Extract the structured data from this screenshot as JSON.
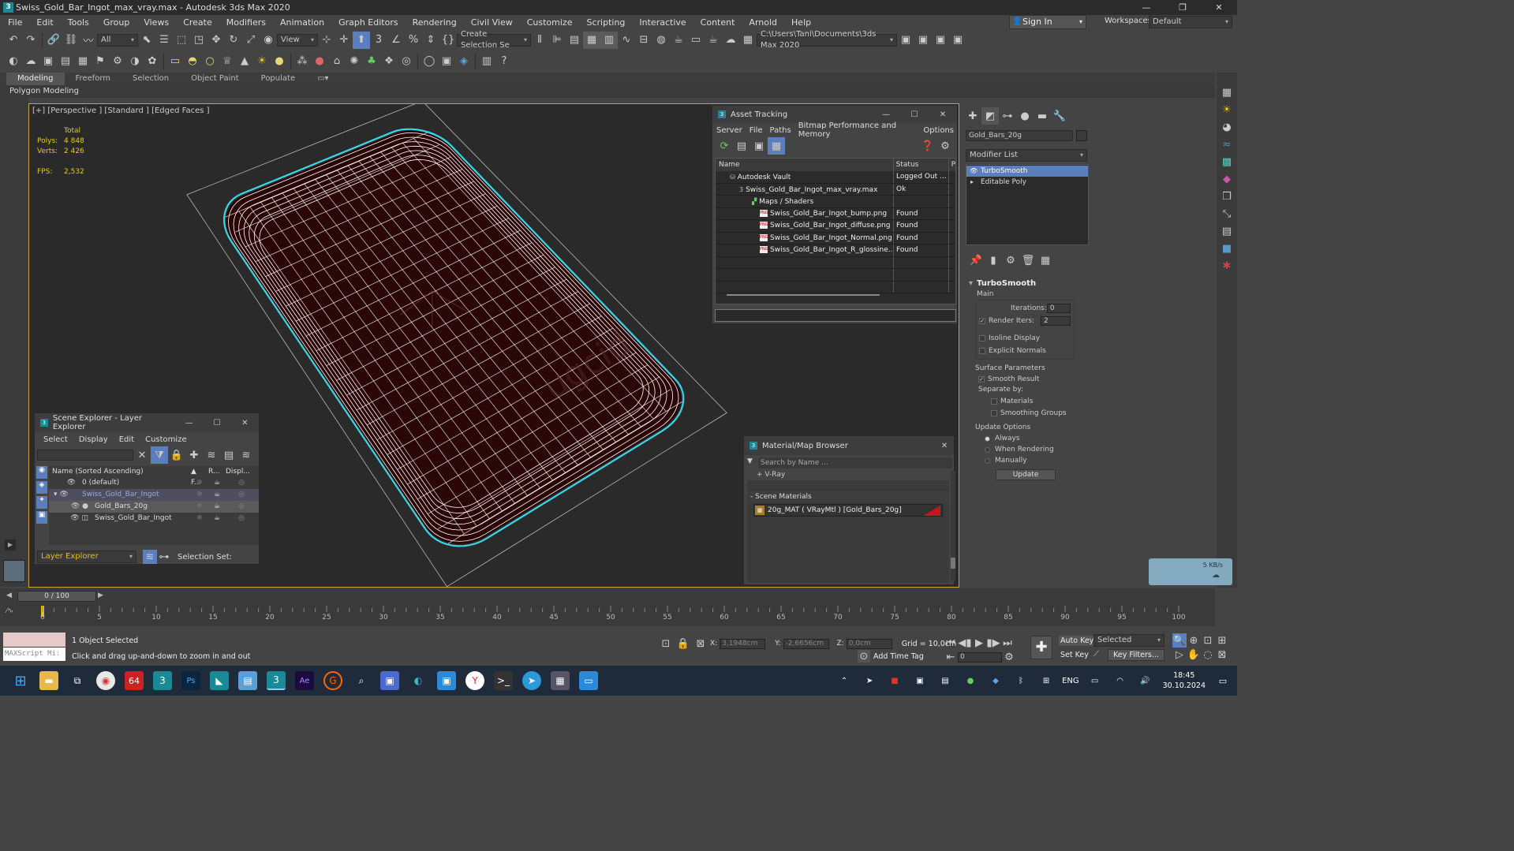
{
  "window": {
    "title": "Swiss_Gold_Bar_Ingot_max_vray.max - Autodesk 3ds Max 2020",
    "app_icon": "3",
    "minimize": "—",
    "maximize": "❐",
    "close": "✕"
  },
  "menu": [
    "File",
    "Edit",
    "Tools",
    "Group",
    "Views",
    "Create",
    "Modifiers",
    "Animation",
    "Graph Editors",
    "Rendering",
    "Civil View",
    "Customize",
    "Scripting",
    "Interactive",
    "Content",
    "Arnold",
    "Help"
  ],
  "account": {
    "signin": "Sign In",
    "workspaces_label": "Workspaces:",
    "workspace_value": "Default"
  },
  "toolbar": {
    "filter_value": "All",
    "refcoord_value": "View",
    "selection_set_value": "Create Selection Se",
    "project_path": "C:\\Users\\Tani\\Documents\\3ds Max 2020"
  },
  "ribbon": {
    "tabs": [
      "Modeling",
      "Freeform",
      "Selection",
      "Object Paint",
      "Populate"
    ],
    "active_tab": "Modeling",
    "sub_label": "Polygon Modeling"
  },
  "viewport": {
    "label": "[+] [Perspective ] [Standard ] [Edged Faces ]",
    "stats": {
      "total_label": "Total",
      "polys_label": "Polys:",
      "polys_value": "4 848",
      "verts_label": "Verts:",
      "verts_value": "2 426",
      "fps_label": "FPS:",
      "fps_value": "2,532"
    },
    "watermark": "ugcid"
  },
  "asset_tracking": {
    "title": "Asset Tracking",
    "menu": [
      "Server",
      "File",
      "Paths",
      "Bitmap Performance and Memory",
      "Options"
    ],
    "columns": [
      "Name",
      "Status",
      "P"
    ],
    "rows": [
      {
        "name": "Autodesk Vault",
        "status": "Logged Out ...",
        "indent": 18,
        "icon": "vault"
      },
      {
        "name": "Swiss_Gold_Bar_Ingot_max_vray.max",
        "status": "Ok",
        "indent": 30,
        "icon": "max"
      },
      {
        "name": "Maps / Shaders",
        "status": "",
        "indent": 46,
        "icon": "maps"
      },
      {
        "name": "Swiss_Gold_Bar_Ingot_bump.png",
        "status": "Found",
        "indent": 56,
        "icon": "png"
      },
      {
        "name": "Swiss_Gold_Bar_Ingot_diffuse.png",
        "status": "Found",
        "indent": 56,
        "icon": "png"
      },
      {
        "name": "Swiss_Gold_Bar_Ingot_Normal.png",
        "status": "Found",
        "indent": 56,
        "icon": "png"
      },
      {
        "name": "Swiss_Gold_Bar_Ingot_R_glossine...",
        "status": "Found",
        "indent": 56,
        "icon": "png"
      }
    ]
  },
  "scene_explorer": {
    "title": "Scene Explorer - Layer Explorer",
    "menu": [
      "Select",
      "Display",
      "Edit",
      "Customize"
    ],
    "columns": [
      "Name (Sorted Ascending)",
      "▲ F...",
      "R...",
      "Displ..."
    ],
    "rows": [
      {
        "name": "0 (default)",
        "state": "normal"
      },
      {
        "name": "Swiss_Gold_Bar_Ingot",
        "state": "selected"
      },
      {
        "name": "Gold_Bars_20g",
        "state": "highlight"
      },
      {
        "name": "Swiss_Gold_Bar_Ingot",
        "state": "normal"
      }
    ],
    "footer_dropdown": "Layer Explorer",
    "selection_set_label": "Selection Set:"
  },
  "material_browser": {
    "title": "Material/Map Browser",
    "search_placeholder": "Search by Name ...",
    "collapsed_group": "+ V-Ray",
    "scene_materials_label": "- Scene Materials",
    "material_item": "20g_MAT ( VRayMtl ) [Gold_Bars_20g]"
  },
  "command_panel": {
    "object_name": "Gold_Bars_20g",
    "modifier_list": "Modifier List",
    "stack": [
      "TurboSmooth",
      "Editable Poly"
    ],
    "selected_modifier": "TurboSmooth",
    "turbosmooth": {
      "title": "TurboSmooth",
      "main_label": "Main",
      "iterations_label": "Iterations:",
      "iterations_value": "0",
      "render_iters_label": "Render Iters:",
      "render_iters_value": "2",
      "isoline_label": "Isoline Display",
      "explicit_normals_label": "Explicit Normals",
      "surface_params_label": "Surface Parameters",
      "smooth_result_label": "Smooth Result",
      "separate_by_label": "Separate by:",
      "materials_label": "Materials",
      "smoothing_groups_label": "Smoothing Groups",
      "update_options_label": "Update Options",
      "always_label": "Always",
      "when_rendering_label": "When Rendering",
      "manually_label": "Manually",
      "update_button": "Update"
    }
  },
  "network_widget": {
    "speed": "5 KB/s"
  },
  "timeline": {
    "frame_display": "0 / 100",
    "ticks": [
      "0",
      "5",
      "10",
      "15",
      "20",
      "25",
      "30",
      "35",
      "40",
      "45",
      "50",
      "55",
      "60",
      "65",
      "70",
      "75",
      "80",
      "85",
      "90",
      "95",
      "100"
    ]
  },
  "status": {
    "maxscript_label": "MAXScript Mi:",
    "selected_text": "1 Object Selected",
    "prompt_text": "Click and drag up-and-down to zoom in and out",
    "x_label": "X:",
    "x_value": "3,1948cm",
    "y_label": "Y:",
    "y_value": "-2,6656cm",
    "z_label": "Z:",
    "z_value": "0,0cm",
    "grid_text": "Grid = 10,0cm",
    "add_time_tag": "Add Time Tag",
    "auto_key": "Auto Key",
    "set_key": "Set Key",
    "selected_dropdown": "Selected",
    "key_filters": "Key Filters...",
    "frame_value": "0"
  },
  "taskbar": {
    "lang": "ENG",
    "time": "18:45",
    "date": "30.10.2024",
    "apps": [
      "start",
      "explorer",
      "task-view",
      "chrome",
      "64",
      "3dsmax-a",
      "photoshop",
      "project",
      "notepad",
      "3dsmax-b",
      "after-effects",
      "grammarly",
      "search",
      "save",
      "edge",
      "sticky",
      "yandex",
      "terminal",
      "telegram",
      "calculator",
      "window"
    ]
  },
  "colors": {
    "viewport_border": "#c9a33a",
    "stats_yellow": "#e8d000",
    "wire_white": "#ffffff",
    "outline_cyan": "#38d6e8",
    "bar_fill": "#2a0606",
    "selection_blue": "#5b7ebd"
  }
}
